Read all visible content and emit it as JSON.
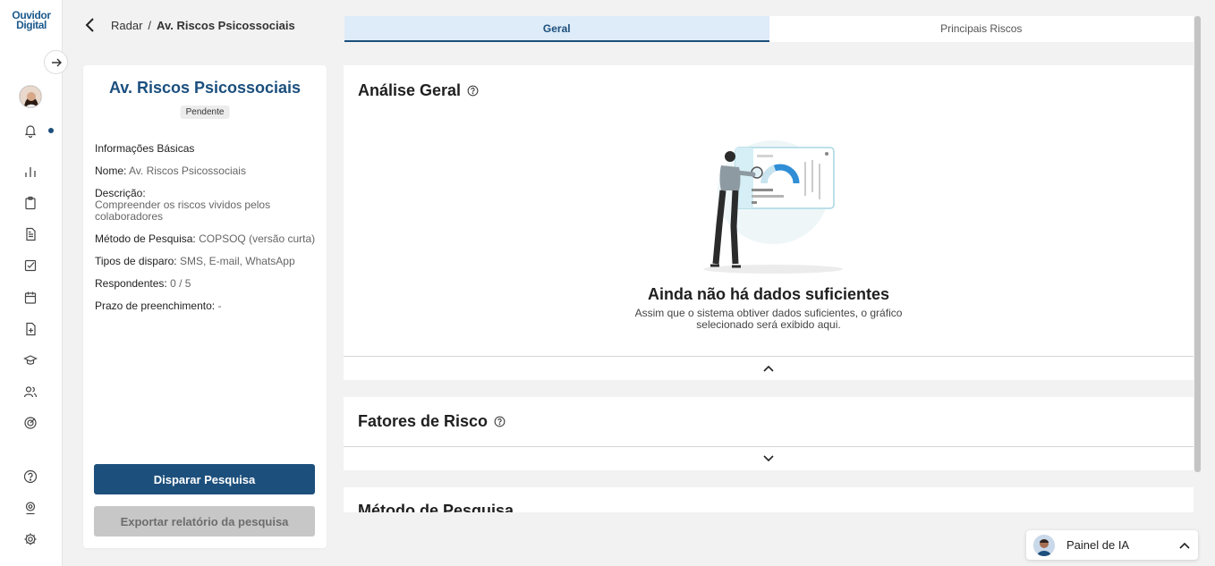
{
  "brand": {
    "line1": "Ouvidor",
    "line2": "Digital"
  },
  "breadcrumb": {
    "parent": "Radar",
    "separator": "/",
    "current": "Av. Riscos Psicossociais"
  },
  "info": {
    "title": "Av. Riscos Psicossociais",
    "status": "Pendente",
    "section_title": "Informações Básicas",
    "name_label": "Nome:",
    "name_value": "Av. Riscos Psicossociais",
    "desc_label": "Descrição:",
    "desc_value": "Compreender os riscos vividos pelos colaboradores",
    "method_label": "Método de Pesquisa:",
    "method_value": "COPSOQ (versão curta)",
    "trigger_label": "Tipos de disparo:",
    "trigger_value": "SMS, E-mail, WhatsApp",
    "resp_label": "Respondentes:",
    "resp_value": "0 / 5",
    "deadline_label": "Prazo de preenchimento:",
    "deadline_value": "-",
    "primary_button": "Disparar Pesquisa",
    "export_button": "Exportar relatório da pesquisa"
  },
  "tabs": [
    {
      "label": "Geral",
      "active": true
    },
    {
      "label": "Principais Riscos",
      "active": false
    }
  ],
  "analysis": {
    "title": "Análise Geral",
    "empty_title": "Ainda não há dados suficientes",
    "empty_desc": "Assim que o sistema obtiver dados suficientes, o gráfico selecionado será exibido aqui."
  },
  "factors": {
    "title": "Fatores de Risco"
  },
  "method": {
    "title": "Método de Pesquisa"
  },
  "ai_panel": {
    "label": "Painel de IA"
  },
  "colors": {
    "primary": "#1d4f7c",
    "tab_active_bg": "#deebf8",
    "disabled": "#c7c7c7"
  }
}
